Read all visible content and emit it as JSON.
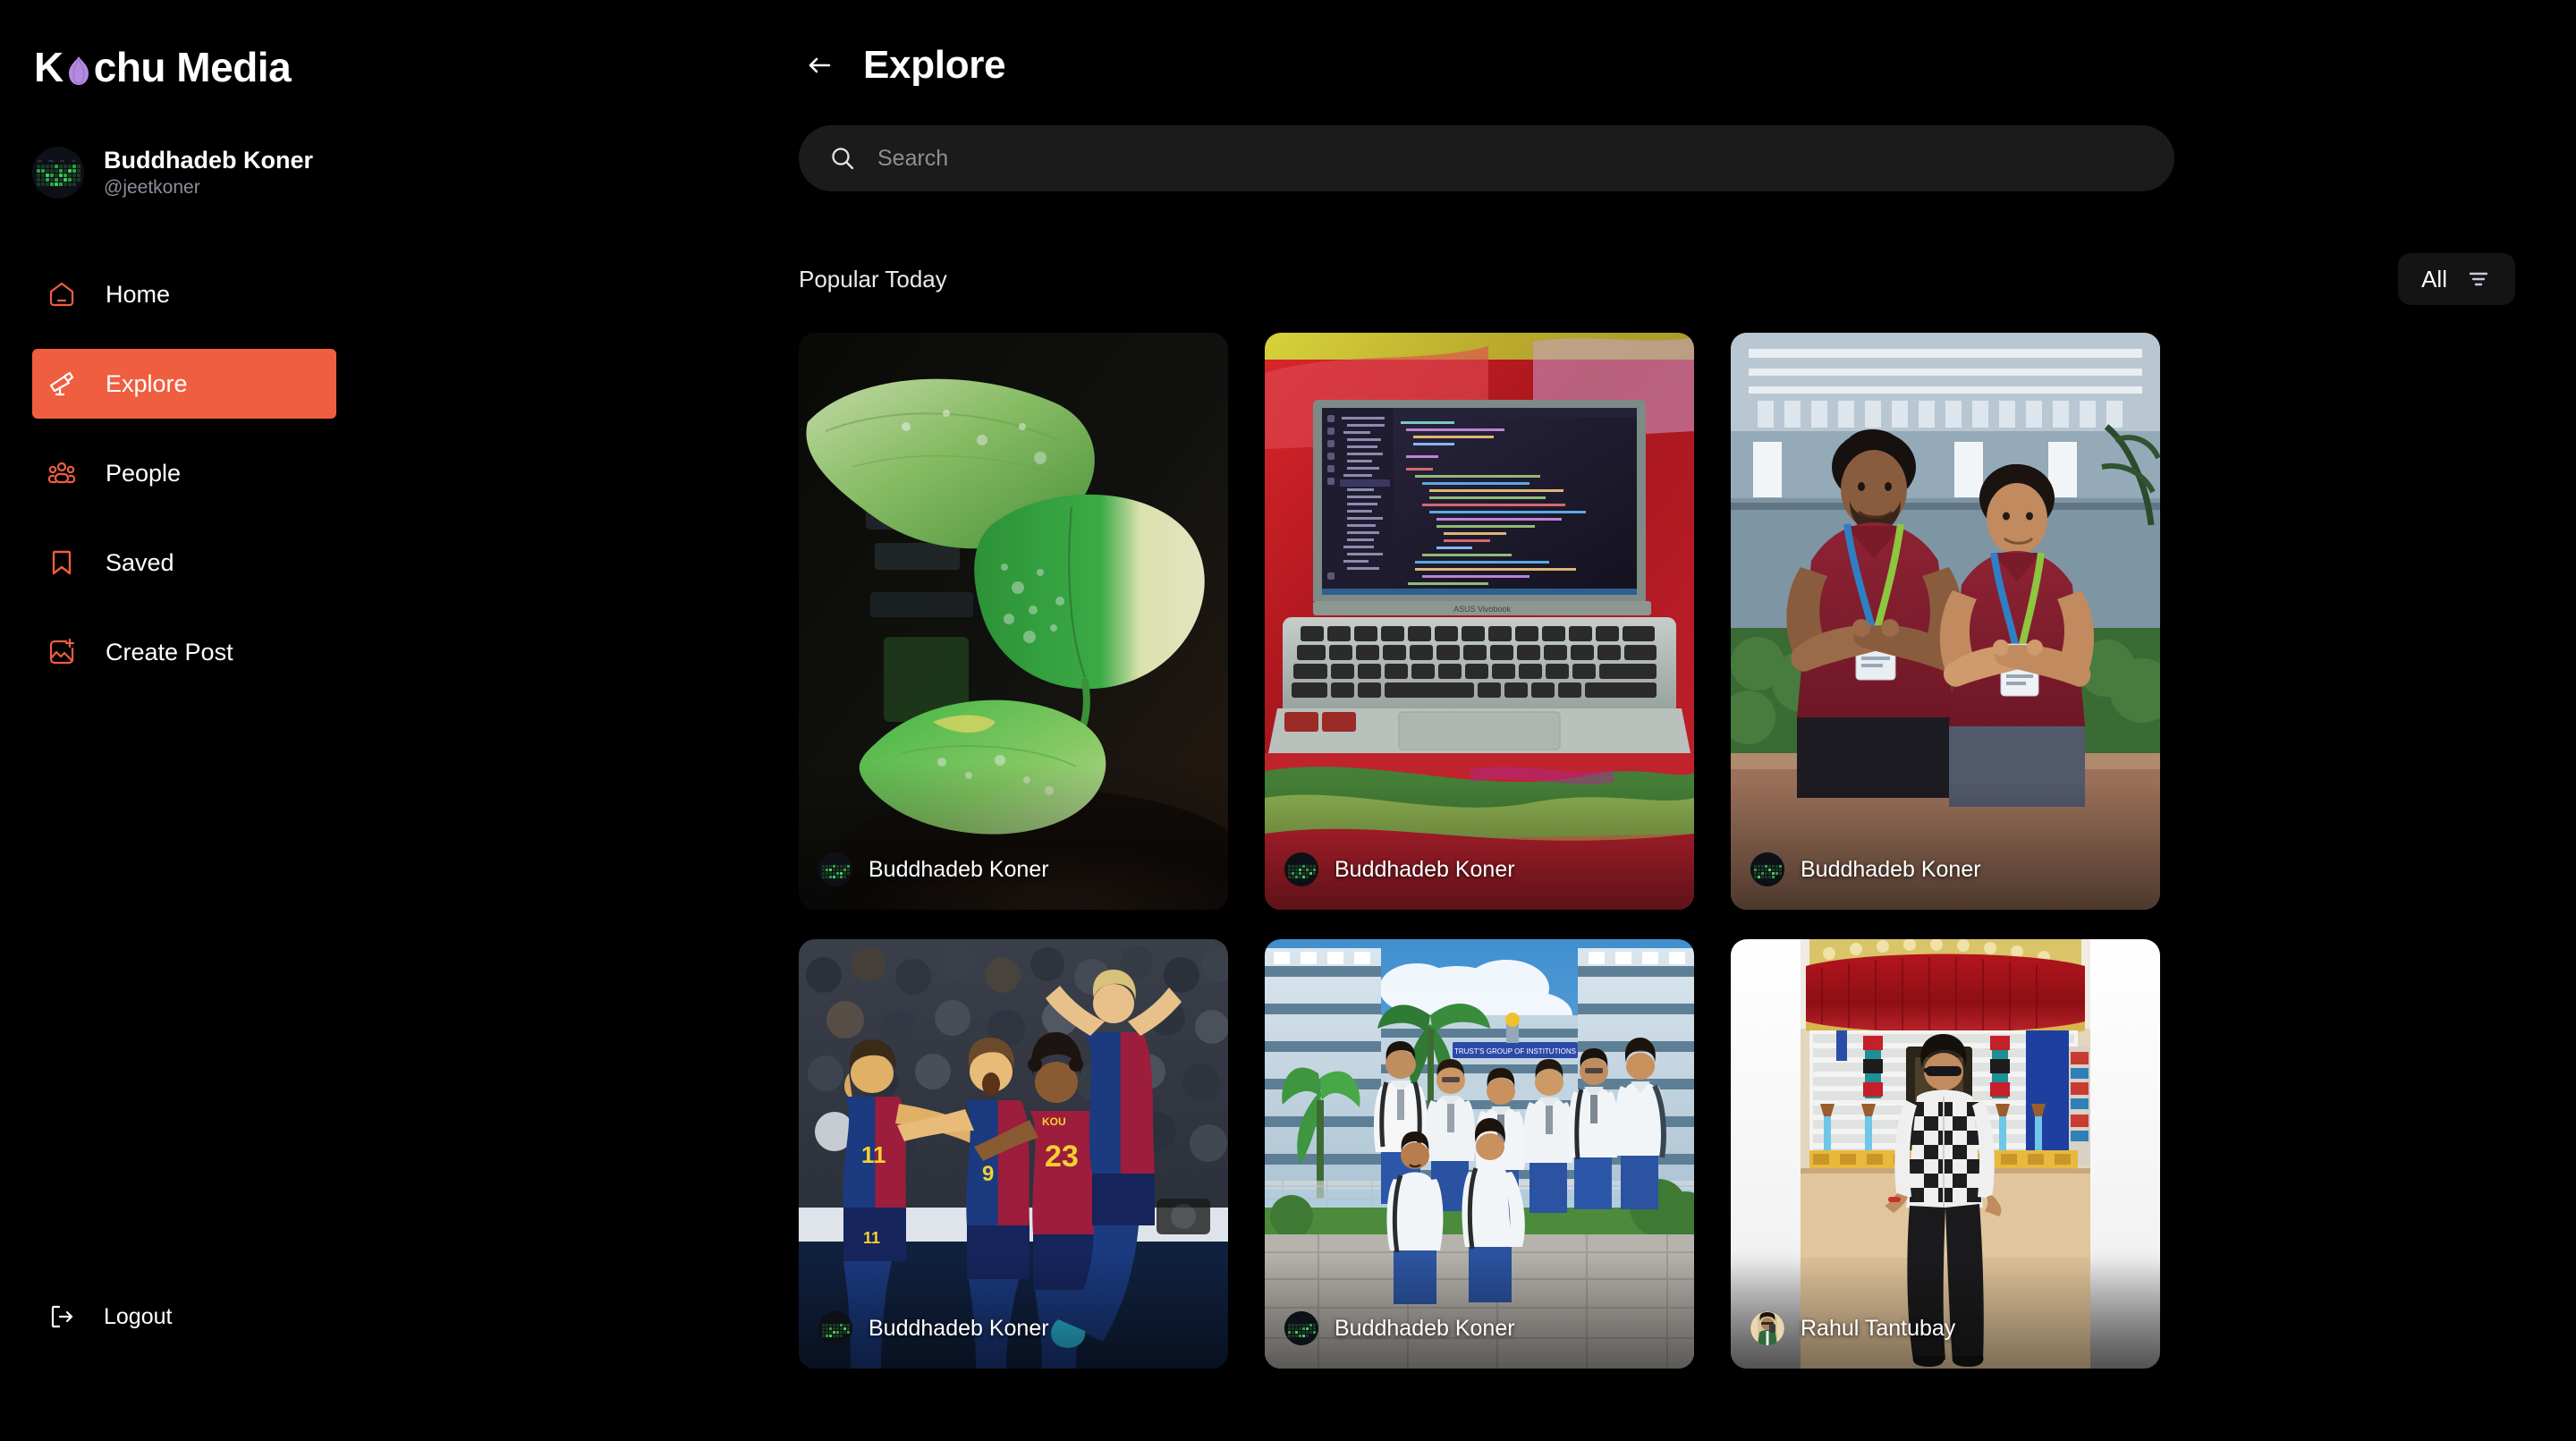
{
  "brand": {
    "name_before": "K",
    "name_after": "chu Media",
    "onion_icon": "onion-icon",
    "onion_color": "#b48ae0"
  },
  "sidebar": {
    "profile": {
      "name": "Buddhadeb Koner",
      "handle": "@jeetkoner",
      "avatar_icon": "contribution-graph-avatar"
    },
    "items": [
      {
        "label": "Home",
        "icon": "home-icon",
        "active": false
      },
      {
        "label": "Explore",
        "icon": "telescope-icon",
        "active": true
      },
      {
        "label": "People",
        "icon": "people-icon",
        "active": false
      },
      {
        "label": "Saved",
        "icon": "bookmark-icon",
        "active": false
      },
      {
        "label": "Create Post",
        "icon": "image-plus-icon",
        "active": false
      }
    ],
    "logout": {
      "label": "Logout",
      "icon": "logout-icon"
    },
    "accent_color": "#ef5e3f"
  },
  "header": {
    "title": "Explore",
    "back_icon": "arrow-left-icon"
  },
  "search": {
    "value": "",
    "placeholder": "Search",
    "icon": "search-icon"
  },
  "section": {
    "title": "Popular Today",
    "filter_label": "All",
    "filter_icon": "filter-lines-icon"
  },
  "grid": {
    "cards": [
      {
        "author": "Buddhadeb Koner",
        "avatar_icon": "contribution-graph-avatar",
        "media": "variegated-pothos-plant-photo"
      },
      {
        "author": "Buddhadeb Koner",
        "avatar_icon": "contribution-graph-avatar",
        "media": "laptop-code-editor-photo"
      },
      {
        "author": "Buddhadeb Koner",
        "avatar_icon": "contribution-graph-avatar",
        "media": "two-students-lanyards-photo"
      },
      {
        "author": "Buddhadeb Koner",
        "avatar_icon": "contribution-graph-avatar",
        "media": "football-celebration-photo"
      },
      {
        "author": "Buddhadeb Koner",
        "avatar_icon": "contribution-graph-avatar",
        "media": "school-group-photo"
      },
      {
        "author": "Rahul Tantubay",
        "avatar_icon": "portrait-avatar",
        "media": "pandal-portrait-photo"
      }
    ]
  }
}
